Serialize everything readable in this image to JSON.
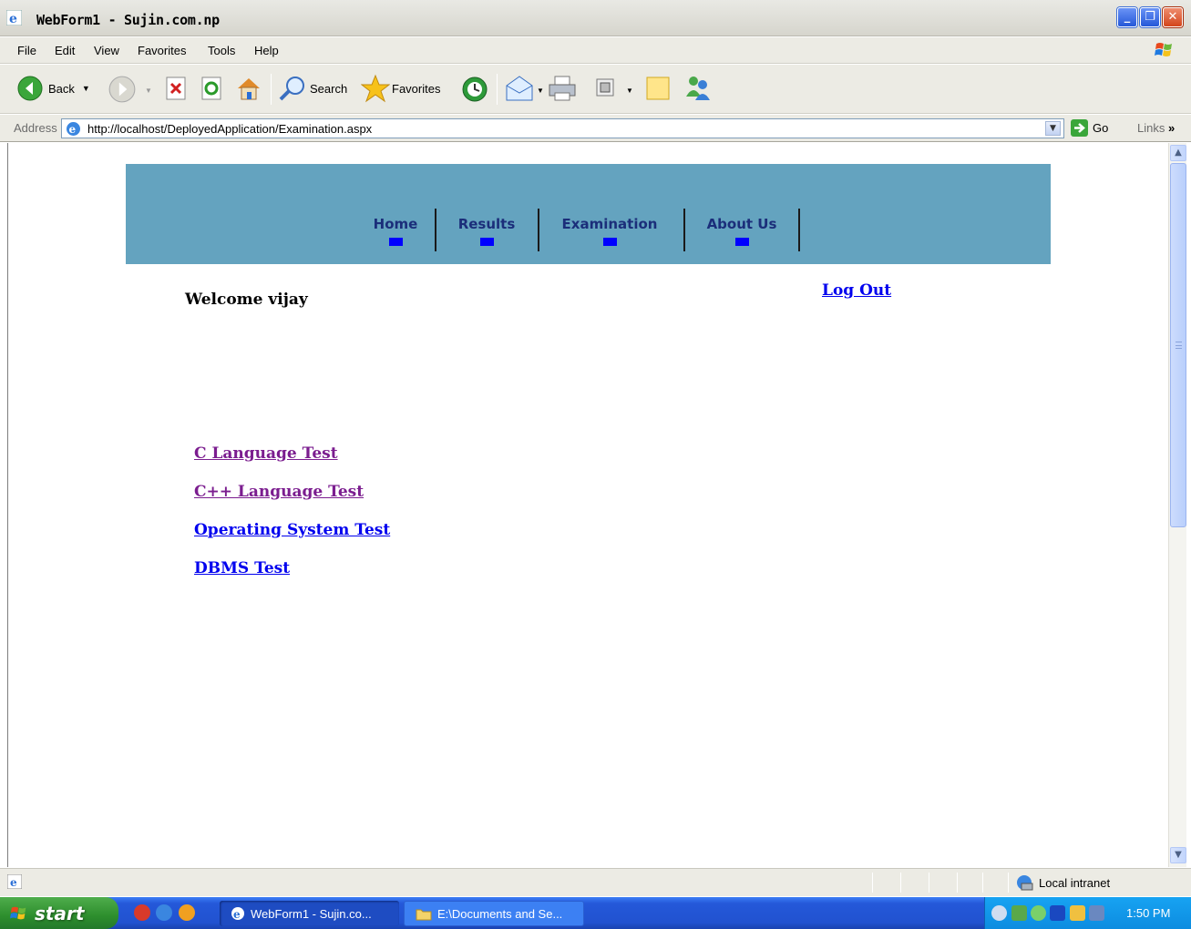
{
  "window": {
    "title": "WebForm1 - Sujin.com.np"
  },
  "menu": [
    "File",
    "Edit",
    "View",
    "Favorites",
    "Tools",
    "Help"
  ],
  "toolbar": {
    "back": "Back",
    "search": "Search",
    "favorites": "Favorites"
  },
  "address": {
    "label": "Address",
    "url": "http://localhost/DeployedApplication/Examination.aspx",
    "go": "Go",
    "links": "Links"
  },
  "nav": [
    {
      "label": "Home"
    },
    {
      "label": "Results"
    },
    {
      "label": "Examination"
    },
    {
      "label": "About Us"
    }
  ],
  "page": {
    "welcome": "Welcome vijay",
    "logout": "Log Out",
    "tests": [
      {
        "label": "C Language Test",
        "visited": true
      },
      {
        "label": "C++ Language Test",
        "visited": true
      },
      {
        "label": "Operating System Test",
        "visited": false
      },
      {
        "label": "DBMS Test",
        "visited": false
      }
    ]
  },
  "status": {
    "zone": "Local intranet"
  },
  "taskbar": {
    "start": "start",
    "tasks": [
      "WebForm1 - Sujin.co...",
      "E:\\Documents and Se..."
    ],
    "clock": "1:50 PM"
  },
  "colors": {
    "banner": "#64a3bf",
    "nav_text": "#1b2e7a",
    "nav_marker": "#0000ff",
    "link": "#0000ee",
    "visited_link": "#7b1d8f"
  }
}
